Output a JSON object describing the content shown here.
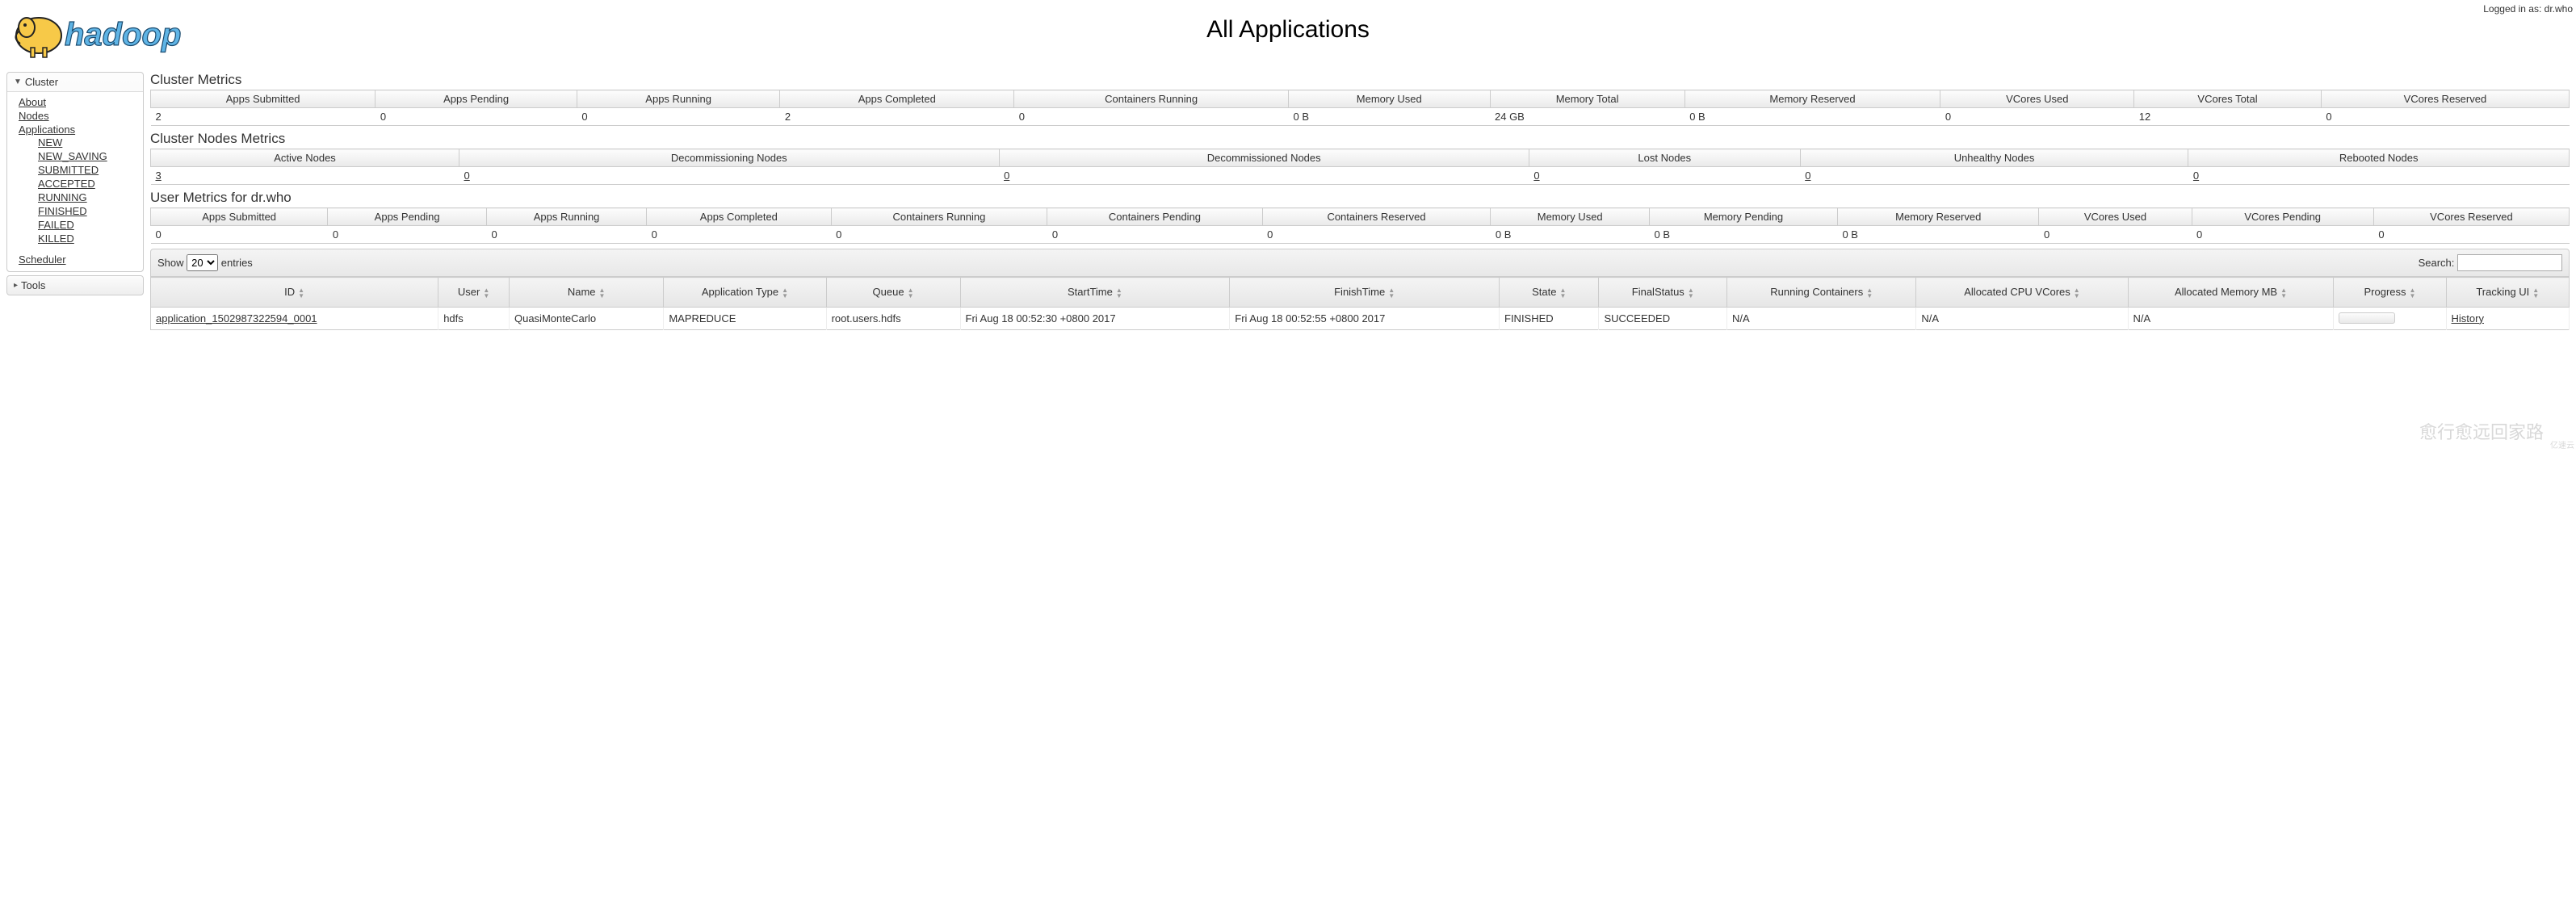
{
  "header": {
    "page_title": "All Applications",
    "logged_in_label": "Logged in as: dr.who"
  },
  "sidebar": {
    "cluster": {
      "label": "Cluster",
      "links": {
        "about": "About",
        "nodes": "Nodes",
        "applications": "Applications",
        "scheduler": "Scheduler"
      },
      "app_states": [
        "NEW",
        "NEW_SAVING",
        "SUBMITTED",
        "ACCEPTED",
        "RUNNING",
        "FINISHED",
        "FAILED",
        "KILLED"
      ]
    },
    "tools": {
      "label": "Tools"
    }
  },
  "cluster_metrics": {
    "title": "Cluster Metrics",
    "headers": [
      "Apps Submitted",
      "Apps Pending",
      "Apps Running",
      "Apps Completed",
      "Containers Running",
      "Memory Used",
      "Memory Total",
      "Memory Reserved",
      "VCores Used",
      "VCores Total",
      "VCores Reserved"
    ],
    "values": [
      "2",
      "0",
      "0",
      "2",
      "0",
      "0 B",
      "24 GB",
      "0 B",
      "0",
      "12",
      "0"
    ]
  },
  "cluster_nodes_metrics": {
    "title": "Cluster Nodes Metrics",
    "headers": [
      "Active Nodes",
      "Decommissioning Nodes",
      "Decommissioned Nodes",
      "Lost Nodes",
      "Unhealthy Nodes",
      "Rebooted Nodes"
    ],
    "values": [
      "3",
      "0",
      "0",
      "0",
      "0",
      "0"
    ]
  },
  "user_metrics": {
    "title": "User Metrics for dr.who",
    "headers": [
      "Apps Submitted",
      "Apps Pending",
      "Apps Running",
      "Apps Completed",
      "Containers Running",
      "Containers Pending",
      "Containers Reserved",
      "Memory Used",
      "Memory Pending",
      "Memory Reserved",
      "VCores Used",
      "VCores Pending",
      "VCores Reserved"
    ],
    "values": [
      "0",
      "0",
      "0",
      "0",
      "0",
      "0",
      "0",
      "0 B",
      "0 B",
      "0 B",
      "0",
      "0",
      "0"
    ]
  },
  "datatable": {
    "show_label": "Show",
    "entries_label": "entries",
    "length_value": "20",
    "search_label": "Search:",
    "columns": [
      "ID",
      "User",
      "Name",
      "Application Type",
      "Queue",
      "StartTime",
      "FinishTime",
      "State",
      "FinalStatus",
      "Running Containers",
      "Allocated CPU VCores",
      "Allocated Memory MB",
      "Progress",
      "Tracking UI"
    ],
    "rows": [
      {
        "id": "application_1502987322594_0001",
        "user": "hdfs",
        "name": "QuasiMonteCarlo",
        "type": "MAPREDUCE",
        "queue": "root.users.hdfs",
        "start": "Fri Aug 18 00:52:30 +0800 2017",
        "finish": "Fri Aug 18 00:52:55 +0800 2017",
        "state": "FINISHED",
        "final_status": "SUCCEEDED",
        "running_containers": "N/A",
        "alloc_cpu": "N/A",
        "alloc_mem": "N/A",
        "tracking": "History"
      }
    ]
  },
  "watermark": {
    "text": "愈行愈远回家路",
    "corner": "亿速云"
  }
}
